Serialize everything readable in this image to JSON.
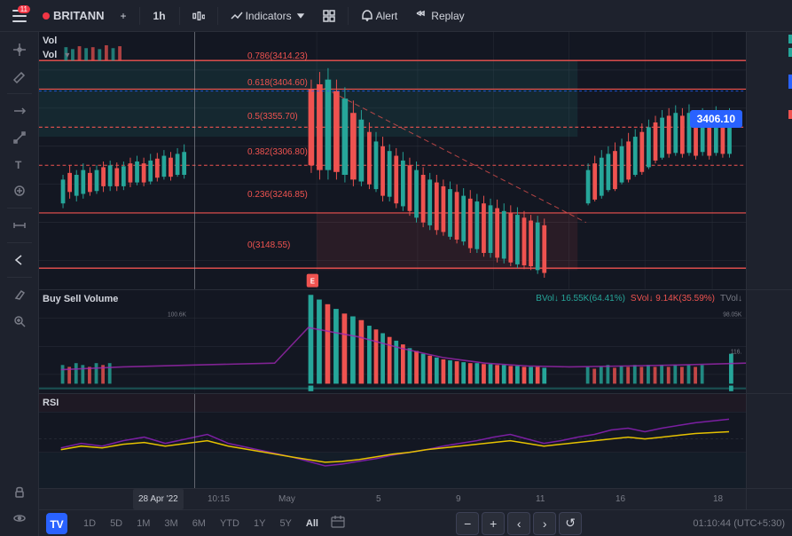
{
  "app": {
    "title": "TradingView"
  },
  "toolbar": {
    "menu_badge": "11",
    "symbol": "BRITANN",
    "symbol_color": "#f23645",
    "add_label": "+",
    "timeframe": "1h",
    "compare_icon": "compare",
    "indicators_label": "Indicators",
    "alert_label": "Alert",
    "replay_label": "Replay",
    "layouts_icon": "layouts"
  },
  "left_toolbar": {
    "tools": [
      {
        "name": "crosshair",
        "icon": "✛"
      },
      {
        "name": "pencil",
        "icon": "✏"
      },
      {
        "name": "horizontal-line",
        "icon": "—"
      },
      {
        "name": "draw-tools",
        "icon": "⟋"
      },
      {
        "name": "text",
        "icon": "T"
      },
      {
        "name": "people-tools",
        "icon": "⚇"
      },
      {
        "name": "measure",
        "icon": "⊢"
      },
      {
        "name": "back",
        "icon": "←"
      },
      {
        "name": "paint",
        "icon": "✎"
      },
      {
        "name": "zoom",
        "icon": "⊕"
      },
      {
        "name": "lock",
        "icon": "🔒"
      },
      {
        "name": "eye",
        "icon": "👁"
      }
    ]
  },
  "chart": {
    "price_label": "3406.10",
    "fib_levels": [
      {
        "label": "0.786(3414.23)",
        "value": "0.786(3414.23)",
        "color": "#ef5350"
      },
      {
        "label": "0.618(3404.60)",
        "value": "0.618(3404.60)",
        "color": "#ef5350"
      },
      {
        "label": "0.5(3355.70)",
        "value": "0.5(3355.70)",
        "color": "#ef5350"
      },
      {
        "label": "0.382(3306.80)",
        "value": "0.382(3306.80)",
        "color": "#ef5350"
      },
      {
        "label": "0.236(3246.85)",
        "value": "0.236(3246.85)",
        "color": "#ef5350"
      },
      {
        "label": "0(3148.55)",
        "value": "0(3148.55)",
        "color": "#ef5350"
      }
    ],
    "vol_label": "Vol",
    "bvs_label": "Buy Sell Volume",
    "bvol_stat": "BVol↓ 16.55K(64.41%)",
    "svol_stat": "SVol↓ 9.14K(35.59%)",
    "tvol_stat": "TVol↓",
    "val_100k": "100.6K",
    "val_98k": "98.05K",
    "val_116k": "116.",
    "rsi_label": "RSI"
  },
  "time_axis": {
    "labels": [
      "28 Apr '22",
      "10:15",
      "May",
      "5",
      "9",
      "11",
      "16",
      "18"
    ]
  },
  "bottom_toolbar": {
    "timeframes": [
      "1D",
      "5D",
      "1M",
      "3M",
      "6M",
      "YTD",
      "1Y",
      "5Y",
      "All"
    ],
    "active": "All",
    "timestamp": "01:10:44 (UTC+5:30)"
  },
  "zoom_controls": {
    "minus": "−",
    "plus": "+",
    "left": "‹",
    "right": "›",
    "replay": "↺"
  }
}
